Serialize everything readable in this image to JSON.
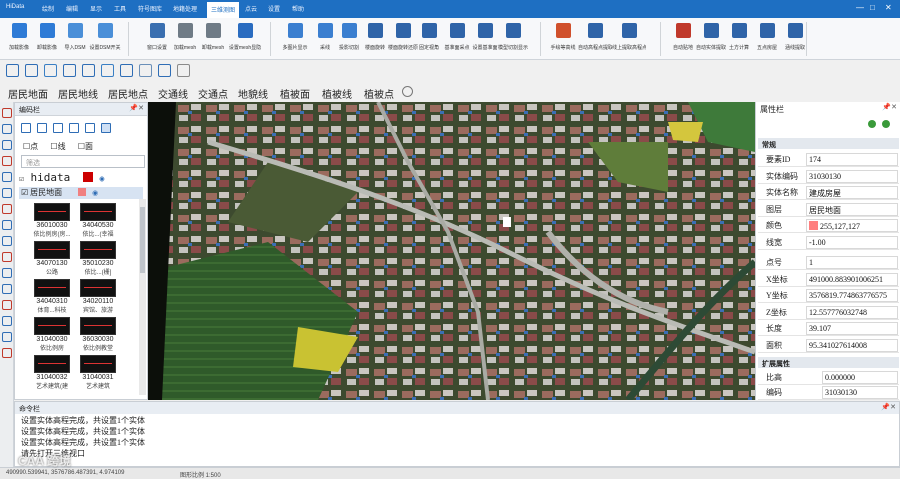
{
  "app": {
    "name": "HiData"
  },
  "tabs": [
    {
      "label": "HiData"
    },
    {
      "label": "绘制"
    },
    {
      "label": "编辑"
    },
    {
      "label": "显示"
    },
    {
      "label": "工具"
    },
    {
      "label": "符号图库"
    },
    {
      "label": "地籍处理"
    },
    {
      "label": "三维测图"
    },
    {
      "label": "点云"
    },
    {
      "label": "设置"
    },
    {
      "label": "帮助"
    }
  ],
  "ribbon": [
    {
      "label": "加载影像",
      "icon": "image-icon",
      "color": "#2e7bd6"
    },
    {
      "label": "卸载影像",
      "icon": "image-remove-icon",
      "color": "#2e7bd6"
    },
    {
      "label": "导入DSM",
      "icon": "dsm-icon",
      "color": "#4a8fd8"
    },
    {
      "label": "设置DSM开关",
      "icon": "dsm-switch-icon",
      "color": "#4a8fd8"
    },
    {
      "label": "窗口设置",
      "icon": "window-icon",
      "color": "#3a6fb0"
    },
    {
      "label": "加载mesh",
      "icon": "mesh-load-icon",
      "color": "#6f7b86"
    },
    {
      "label": "卸载mesh",
      "icon": "mesh-unload-icon",
      "color": "#6f7b86"
    },
    {
      "label": "设置mesh显隐",
      "icon": "eye-icon",
      "color": "#2a6cc0"
    },
    {
      "label": "多图片显示",
      "icon": "multi-image-icon",
      "color": "#3b7fd0"
    },
    {
      "label": "采线",
      "icon": "line-icon",
      "color": "#3b7fd0"
    },
    {
      "label": "投影切割",
      "icon": "cut-icon",
      "color": "#3b7fd0"
    },
    {
      "label": "楼面旋转",
      "icon": "rotate-icon",
      "color": "#2f64a8"
    },
    {
      "label": "楼面旋转还原",
      "icon": "restore-icon",
      "color": "#2f64a8"
    },
    {
      "label": "固定视角",
      "icon": "view-lock-icon",
      "color": "#2f64a8"
    },
    {
      "label": "基准面采点",
      "icon": "base-point-icon",
      "color": "#2f64a8"
    },
    {
      "label": "设置基准面",
      "icon": "base-set-icon",
      "color": "#2f64a8"
    },
    {
      "label": "模型切割显示",
      "icon": "model-cut-icon",
      "color": "#2f64a8"
    },
    {
      "label": "手绘等高线",
      "icon": "contour-draw-icon",
      "color": "#d0502c"
    },
    {
      "label": "自动高程点提取",
      "icon": "elevation-icon",
      "color": "#2f64a8"
    },
    {
      "label": "线上提取高程点",
      "icon": "line-elevation-icon",
      "color": "#2f64a8"
    },
    {
      "label": "自动贴地",
      "icon": "ground-icon",
      "color": "#c0392b"
    },
    {
      "label": "自动实体提取",
      "icon": "entity-extract-icon",
      "color": "#2f64a8"
    },
    {
      "label": "土方计算",
      "icon": "earthwork-icon",
      "color": "#2f64a8"
    },
    {
      "label": "五点房屋",
      "icon": "house-icon",
      "color": "#2f64a8"
    },
    {
      "label": "涵线提取",
      "icon": "culvert-icon",
      "color": "#2f64a8"
    }
  ],
  "toolbar2": [
    "layer-icon",
    "image-icon",
    "grid-icon",
    "globe-icon",
    "tag-icon",
    "camera-icon",
    "cube-icon",
    "curve-icon",
    "triangle-icon",
    "settings-icon"
  ],
  "toolbar3": [
    "居民地面",
    "居民地线",
    "居民地点",
    "交通线",
    "交通点",
    "地貌线",
    "植被面",
    "植被线",
    "植被点"
  ],
  "left_panel": {
    "title": "编码栏",
    "filters": [
      "点",
      "线",
      "面"
    ],
    "filter_placeholder": "筛选",
    "root_label": "hidata",
    "group_label": "居民地面",
    "symbols": [
      {
        "code": "36010030",
        "name": "依比例房(房..."
      },
      {
        "code": "34040530",
        "name": "依比...(幸福"
      },
      {
        "code": "34070130",
        "name": "公路"
      },
      {
        "code": "35010230",
        "name": "依比...(栅]"
      },
      {
        "code": "34040310",
        "name": "体育...科枝"
      },
      {
        "code": "34020110",
        "name": "宾馆、旅游"
      },
      {
        "code": "31040030",
        "name": "依比例房"
      },
      {
        "code": "36030030",
        "name": "依比例教堂"
      },
      {
        "code": "31040032",
        "name": "艺术建筑(建"
      },
      {
        "code": "31040031",
        "name": "艺术建筑"
      }
    ]
  },
  "properties": {
    "title": "属性栏",
    "section_basic": "常规",
    "section_ext": "扩展属性",
    "rows": [
      {
        "key": "要素ID",
        "value": "174"
      },
      {
        "key": "实体编码",
        "value": "31030130"
      },
      {
        "key": "实体名称",
        "value": "建成房屋"
      },
      {
        "key": "图层",
        "value": "居民地面"
      },
      {
        "key": "颜色",
        "value": "255,127,127"
      },
      {
        "key": "线宽",
        "value": "-1.00"
      },
      {
        "key": "点号",
        "value": "1"
      },
      {
        "key": "X坐标",
        "value": "491000.883901006251"
      },
      {
        "key": "Y坐标",
        "value": "3576819.774863776575"
      },
      {
        "key": "Z坐标",
        "value": "12.557776032748"
      },
      {
        "key": "长度",
        "value": "39.107"
      },
      {
        "key": "面积",
        "value": "95.341027614008"
      }
    ],
    "ext_rows": [
      {
        "key": "比高",
        "value": "0.000000"
      },
      {
        "key": "编码",
        "value": "31030130"
      }
    ]
  },
  "command": {
    "title": "命令栏",
    "lines": [
      "设置实体高程完成，共设置1个实体",
      "设置实体高程完成，共设置1个实体",
      "设置实体高程完成，共设置1个实体",
      "请先打开三维视口"
    ]
  },
  "status": {
    "coords": "490990.539941, 3576786.487391, 4.974109",
    "scale": "图形比例 1:500"
  },
  "watermark": "CAA 跨境",
  "colors": {
    "accent": "#1e6fc2",
    "entity": "#ff7f7f"
  }
}
